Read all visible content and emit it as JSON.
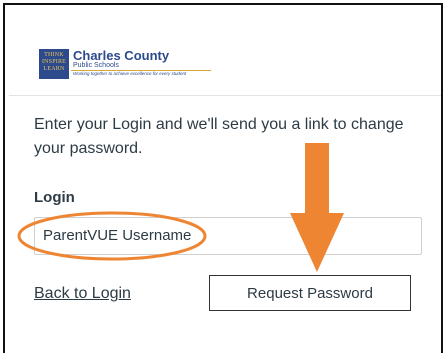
{
  "logo": {
    "mark_lines": [
      "THINK",
      "INSPIRE",
      "LEARN"
    ],
    "title": "Charles County",
    "subtitle": "Public Schools",
    "tagline": "Working together to achieve excellence for every student"
  },
  "form": {
    "instruction": "Enter your Login and we'll send you a link to change your password.",
    "login_label": "Login",
    "login_value": "ParentVUE Username",
    "back_link": "Back to Login",
    "request_button": "Request Password"
  },
  "annotations": {
    "highlight_color": "#ee8533",
    "arrow_color": "#ee8533",
    "arrow_target": "request-password-button",
    "ellipse_target": "login-input"
  }
}
